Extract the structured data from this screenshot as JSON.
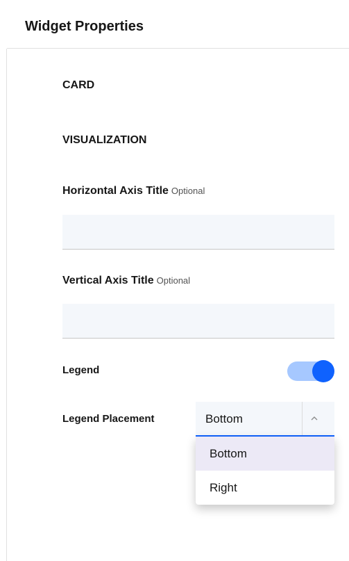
{
  "panel": {
    "title": "Widget Properties"
  },
  "sections": {
    "card": "CARD",
    "visualization": "VISUALIZATION"
  },
  "fields": {
    "horizontal_axis_title": {
      "label": "Horizontal Axis Title",
      "optional": "Optional",
      "value": ""
    },
    "vertical_axis_title": {
      "label": "Vertical Axis Title",
      "optional": "Optional",
      "value": ""
    },
    "legend": {
      "label": "Legend",
      "enabled": true,
      "track_color": "#a6c8ff",
      "knob_color": "#0f62fe"
    },
    "legend_placement": {
      "label": "Legend Placement",
      "selected": "Bottom",
      "options": [
        "Bottom",
        "Right"
      ],
      "accent_color": "#0f62fe",
      "highlight_color": "#ece9f6"
    }
  }
}
